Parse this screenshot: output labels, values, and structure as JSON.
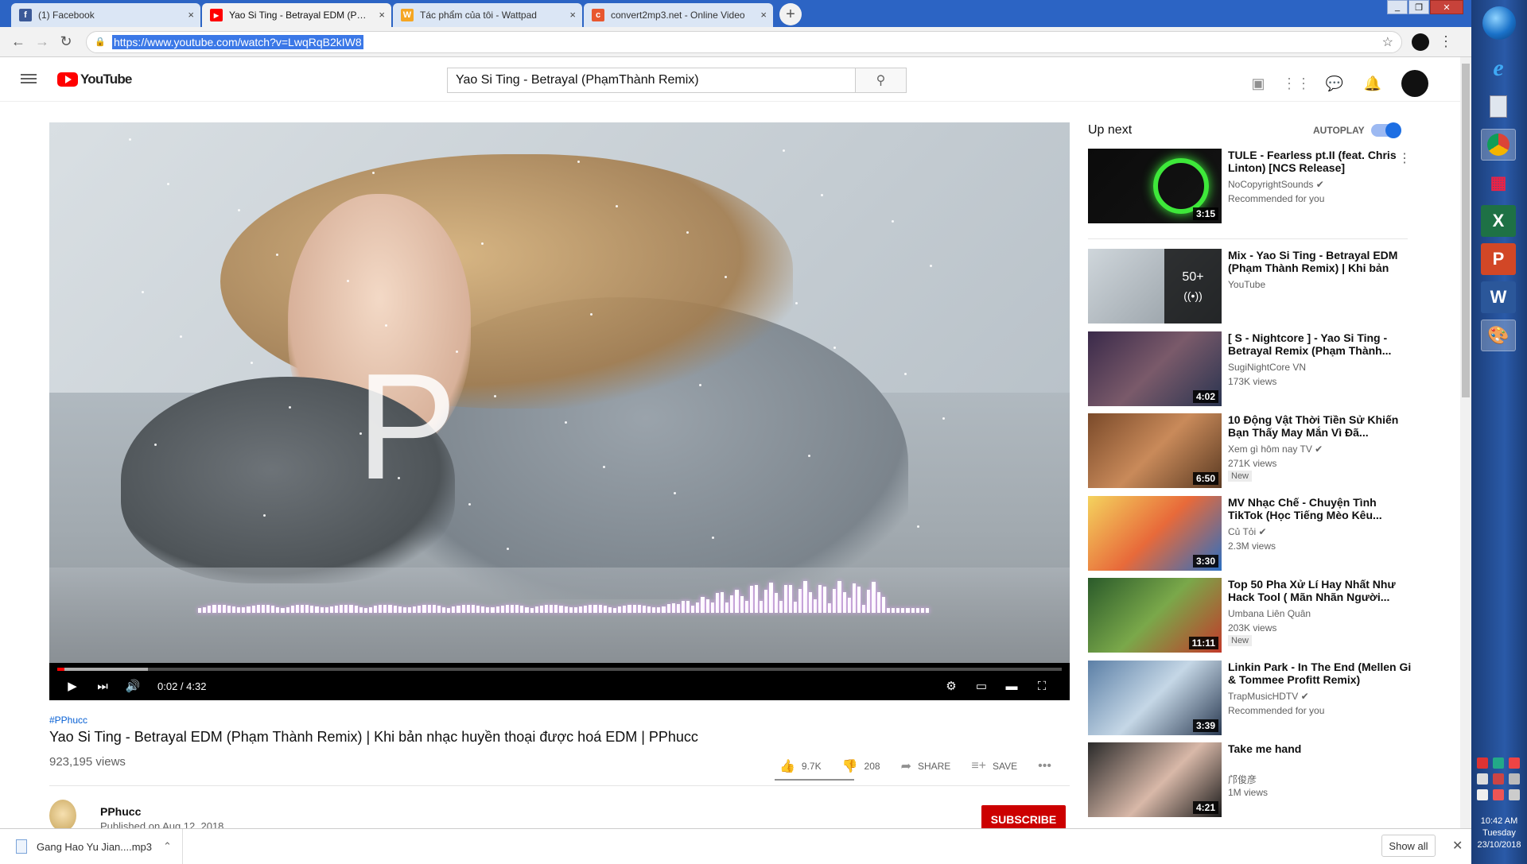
{
  "browser": {
    "tabs": [
      {
        "title": "(1) Facebook",
        "favicon": "facebook-icon",
        "color": "#3b5998",
        "glyph": "f"
      },
      {
        "title": "Yao Si Ting - Betrayal EDM (Phạm",
        "favicon": "youtube-icon",
        "color": "#ff0000",
        "glyph": "▶",
        "active": true
      },
      {
        "title": "Tác phẩm của tôi - Wattpad",
        "favicon": "wattpad-icon",
        "color": "#f5a623",
        "glyph": "W"
      },
      {
        "title": "convert2mp3.net - Online Video",
        "favicon": "convert2mp3-icon",
        "color": "#e8572f",
        "glyph": "c"
      }
    ],
    "url": "https://www.youtube.com/watch?v=LwqRqB2kIW8"
  },
  "masthead": {
    "logo_text": "YouTube",
    "search_value": "Yao Si Ting - Betrayal (PhạmThành Remix)",
    "icons": [
      "create-video-icon",
      "apps-icon",
      "messages-icon",
      "notifications-icon"
    ]
  },
  "player": {
    "overlay_letter": "P",
    "current_time": "0:02",
    "duration": "4:32",
    "time_text": "0:02 / 4:32",
    "progress_fraction": 0.007,
    "buffered_fraction": 0.09
  },
  "video": {
    "hashtag": "#PPhucc",
    "title": "Yao Si Ting - Betrayal EDM (Phạm Thành Remix) | Khi bản nhạc huyền thoại được hoá EDM | PPhucc",
    "views": "923,195 views",
    "likes": "9.7K",
    "dislikes": "208",
    "share_label": "SHARE",
    "save_label": "SAVE",
    "channel": "PPhucc",
    "published": "Published on Aug 12, 2018",
    "subscribe_label": "SUBSCRIBE"
  },
  "sidebar": {
    "up_next": "Up next",
    "autoplay_label": "AUTOPLAY",
    "autoplay_on": true,
    "items": [
      {
        "title": "TULE - Fearless pt.II (feat. Chris Linton) [NCS Release]",
        "channel": "NoCopyrightSounds ✔",
        "meta": "Recommended for you",
        "duration": "3:15",
        "thumb": "ncs"
      },
      {
        "title": "Mix - Yao Si Ting - Betrayal EDM (Phạm Thành Remix) | Khi bản nhạ...",
        "channel": "YouTube",
        "meta": "",
        "mix_count": "50+",
        "thumb": "mix"
      },
      {
        "title": "[ S - Nightcore ] - Yao Si Ting - Betrayal Remix (Phạm Thành...",
        "channel": "SugiNightCore VN",
        "meta": "173K views",
        "duration": "4:02",
        "thumb": "night"
      },
      {
        "title": "10 Động Vật Thời Tiền Sử Khiến Bạn Thấy May Mắn Vì Đã...",
        "channel": "Xem gì hôm nay TV ✔",
        "meta": "271K views",
        "badge": "New",
        "duration": "6:50",
        "thumb": "animal"
      },
      {
        "title": "MV Nhạc Chế - Chuyện Tình TikTok (Học Tiếng Mèo Kêu...",
        "channel": "Củ Tỏi ✔",
        "meta": "2.3M views",
        "duration": "3:30",
        "thumb": "tiktok"
      },
      {
        "title": "Top 50 Pha Xử Lí Hay Nhất Như Hack Tool ( Mãn Nhãn Người...",
        "channel": "Umbana Liên Quân",
        "meta": "203K views",
        "badge": "New",
        "duration": "11:11",
        "thumb": "game"
      },
      {
        "title": "Linkin Park - In The End (Mellen Gi & Tommee Profitt Remix)",
        "channel": "TrapMusicHDTV ✔",
        "meta": "Recommended for you",
        "duration": "3:39",
        "thumb": "linkin"
      },
      {
        "title": "Take me hand",
        "channel": "邝俊彦",
        "meta": "1M views",
        "duration": "4:21",
        "thumb": "girl"
      }
    ]
  },
  "downloads": {
    "file": "Gang Hao Yu Jian....mp3",
    "show_all": "Show all"
  },
  "taskbar": {
    "time": "10:42 AM",
    "day": "Tuesday",
    "date": "23/10/2018"
  }
}
